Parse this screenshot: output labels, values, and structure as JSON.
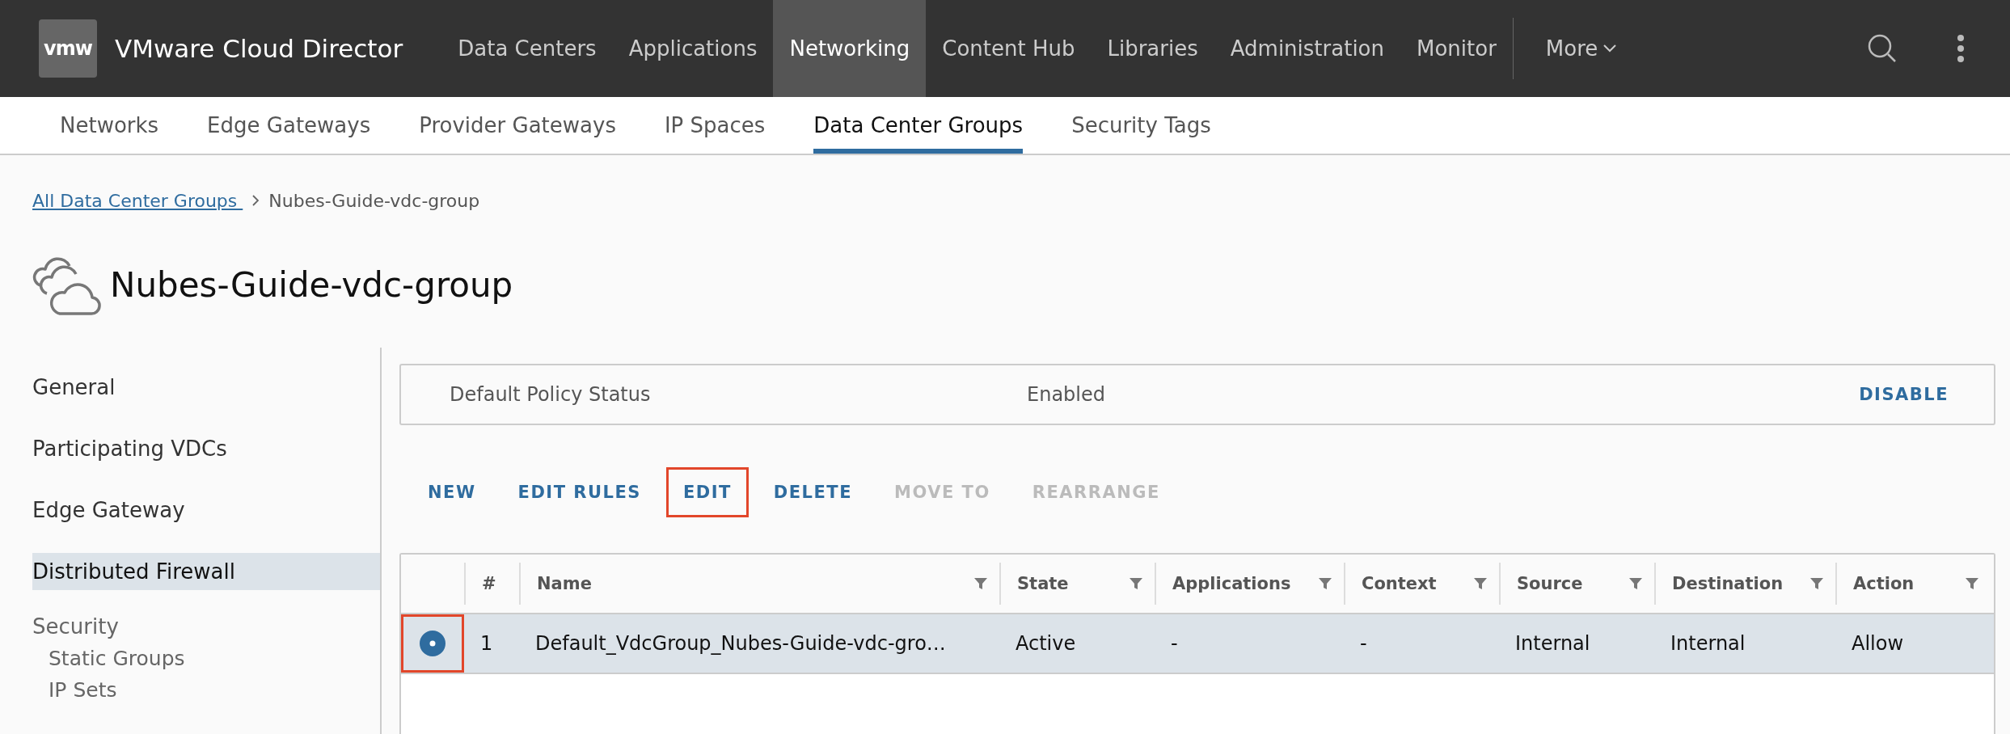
{
  "header": {
    "logo": "vmw",
    "product": "VMware Cloud Director",
    "nav": [
      {
        "label": "Data Centers",
        "selected": false
      },
      {
        "label": "Applications",
        "selected": false
      },
      {
        "label": "Networking",
        "selected": true
      },
      {
        "label": "Content Hub",
        "selected": false
      },
      {
        "label": "Libraries",
        "selected": false
      },
      {
        "label": "Administration",
        "selected": false
      },
      {
        "label": "Monitor",
        "selected": false
      }
    ],
    "more": "More"
  },
  "subnav": [
    {
      "label": "Networks",
      "selected": false
    },
    {
      "label": "Edge Gateways",
      "selected": false
    },
    {
      "label": "Provider Gateways",
      "selected": false
    },
    {
      "label": "IP Spaces",
      "selected": false
    },
    {
      "label": "Data Center Groups",
      "selected": true
    },
    {
      "label": "Security Tags",
      "selected": false
    }
  ],
  "breadcrumb": {
    "link": "All Data Center Groups ",
    "current": "Nubes-Guide-vdc-group"
  },
  "page_title": "Nubes-Guide-vdc-group",
  "sidebar": [
    {
      "label": "General",
      "selected": false
    },
    {
      "label": "Participating VDCs",
      "selected": false
    },
    {
      "label": "Edge Gateway",
      "selected": false
    },
    {
      "label": "Distributed Firewall",
      "selected": true
    },
    {
      "label": "Security",
      "selected": false,
      "children": [
        {
          "label": "Static Groups"
        },
        {
          "label": "IP Sets"
        }
      ]
    }
  ],
  "policy": {
    "label": "Default Policy Status",
    "value": "Enabled",
    "action": "DISABLE"
  },
  "toolbar": [
    {
      "label": "NEW",
      "disabled": false,
      "highlighted": false
    },
    {
      "label": "EDIT RULES",
      "disabled": false,
      "highlighted": false
    },
    {
      "label": "EDIT",
      "disabled": false,
      "highlighted": true
    },
    {
      "label": "DELETE",
      "disabled": false,
      "highlighted": false
    },
    {
      "label": "MOVE TO",
      "disabled": true,
      "highlighted": false
    },
    {
      "label": "REARRANGE",
      "disabled": true,
      "highlighted": false
    }
  ],
  "table": {
    "columns": [
      {
        "label": "#",
        "filter": false
      },
      {
        "label": "Name",
        "filter": true
      },
      {
        "label": "State",
        "filter": true
      },
      {
        "label": "Applications",
        "filter": true
      },
      {
        "label": "Context",
        "filter": true
      },
      {
        "label": "Source",
        "filter": true
      },
      {
        "label": "Destination",
        "filter": true
      },
      {
        "label": "Action",
        "filter": true
      }
    ],
    "rows": [
      {
        "selected": true,
        "highlighted": true,
        "cells": [
          "1",
          "Default_VdcGroup_Nubes-Guide-vdc-gro…",
          "Active",
          "-",
          "-",
          "Internal",
          "Internal",
          "Allow"
        ]
      }
    ]
  }
}
